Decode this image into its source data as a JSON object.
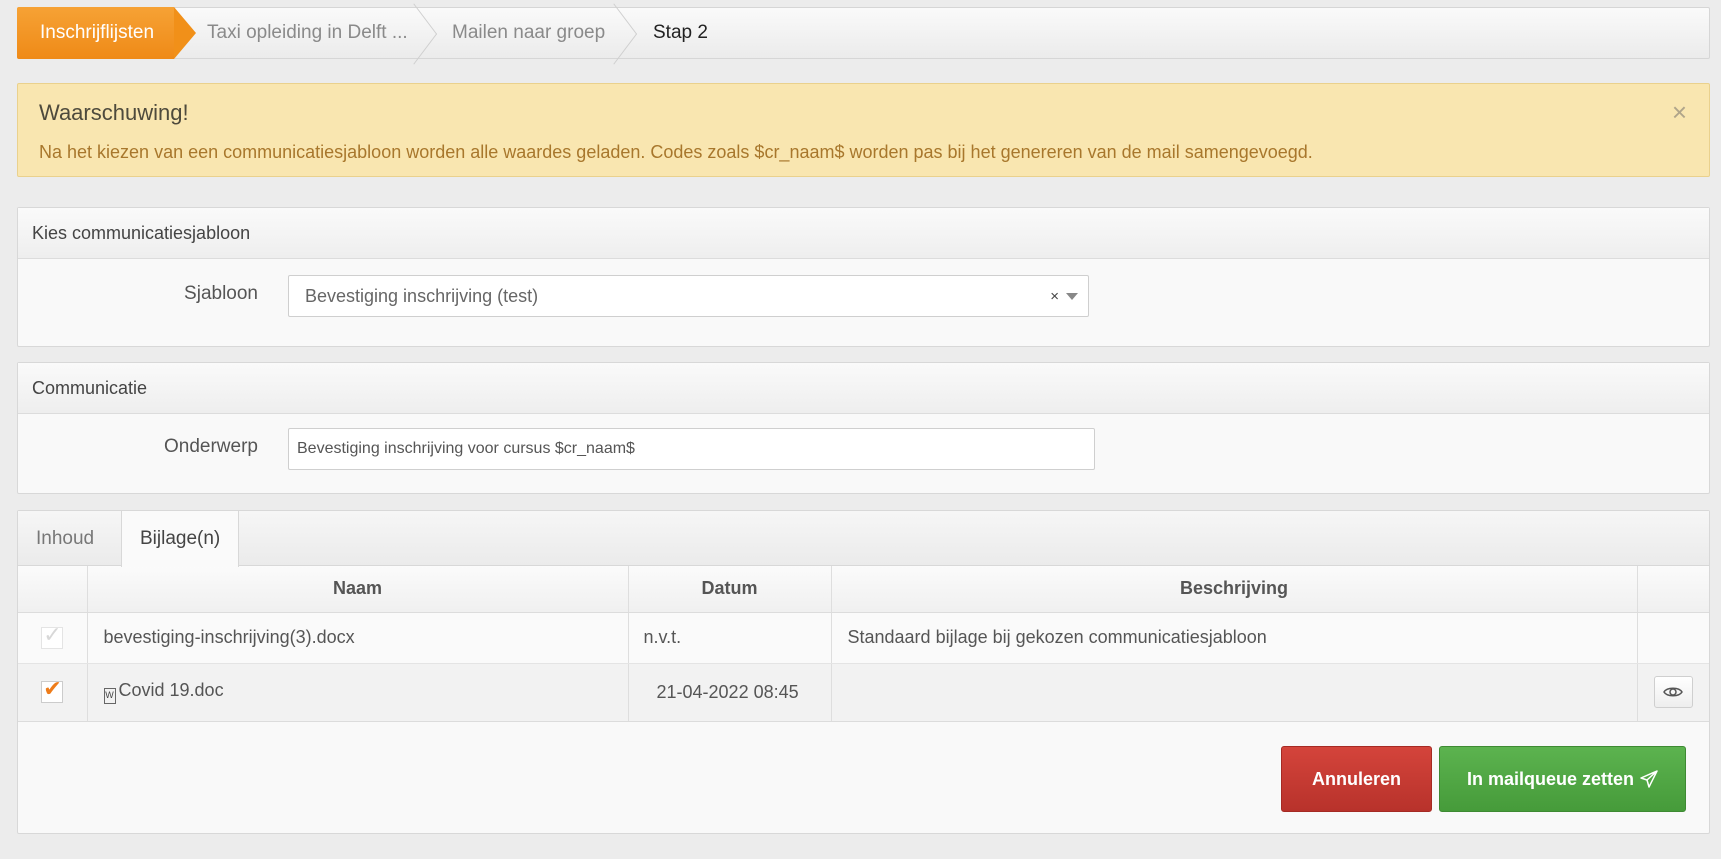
{
  "breadcrumb": {
    "items": [
      {
        "label": "Inschrijflijsten"
      },
      {
        "label": "Taxi opleiding in Delft ..."
      },
      {
        "label": "Mailen naar groep"
      },
      {
        "label": "Stap 2"
      }
    ]
  },
  "alert": {
    "title": "Waarschuwing!",
    "message": "Na het kiezen van een communicatiesjabloon worden alle waardes geladen. Codes zoals $cr_naam$ worden pas bij het genereren van de mail samengevoegd.",
    "close": "×"
  },
  "template_panel": {
    "title": "Kies communicatiesjabloon",
    "field_label": "Sjabloon",
    "selected_value": "Bevestiging inschrijving (test)",
    "clear": "×"
  },
  "communication_panel": {
    "title": "Communicatie",
    "field_label": "Onderwerp",
    "subject_value": "Bevestiging inschrijving voor cursus $cr_naam$"
  },
  "tabs": [
    {
      "label": "Inhoud",
      "active": false
    },
    {
      "label": "Bijlage(n)",
      "active": true
    }
  ],
  "attachments": {
    "columns": [
      "Naam",
      "Datum",
      "Beschrijving"
    ],
    "rows": [
      {
        "checked": true,
        "disabled": true,
        "name": "bevestiging-inschrijving(3).docx",
        "date": "n.v.t.",
        "description": "Standaard bijlage bij gekozen communicatiesjabloon"
      },
      {
        "checked": true,
        "disabled": false,
        "name": "Covid 19.doc",
        "date": "21-04-2022 08:45",
        "description": ""
      }
    ]
  },
  "actions": {
    "cancel_label": "Annuleren",
    "queue_label": "In mailqueue zetten"
  },
  "colors": {
    "accent": "#ef8a17",
    "danger": "#c23a32",
    "success": "#50a744",
    "warning_bg": "#f9e6b0"
  }
}
